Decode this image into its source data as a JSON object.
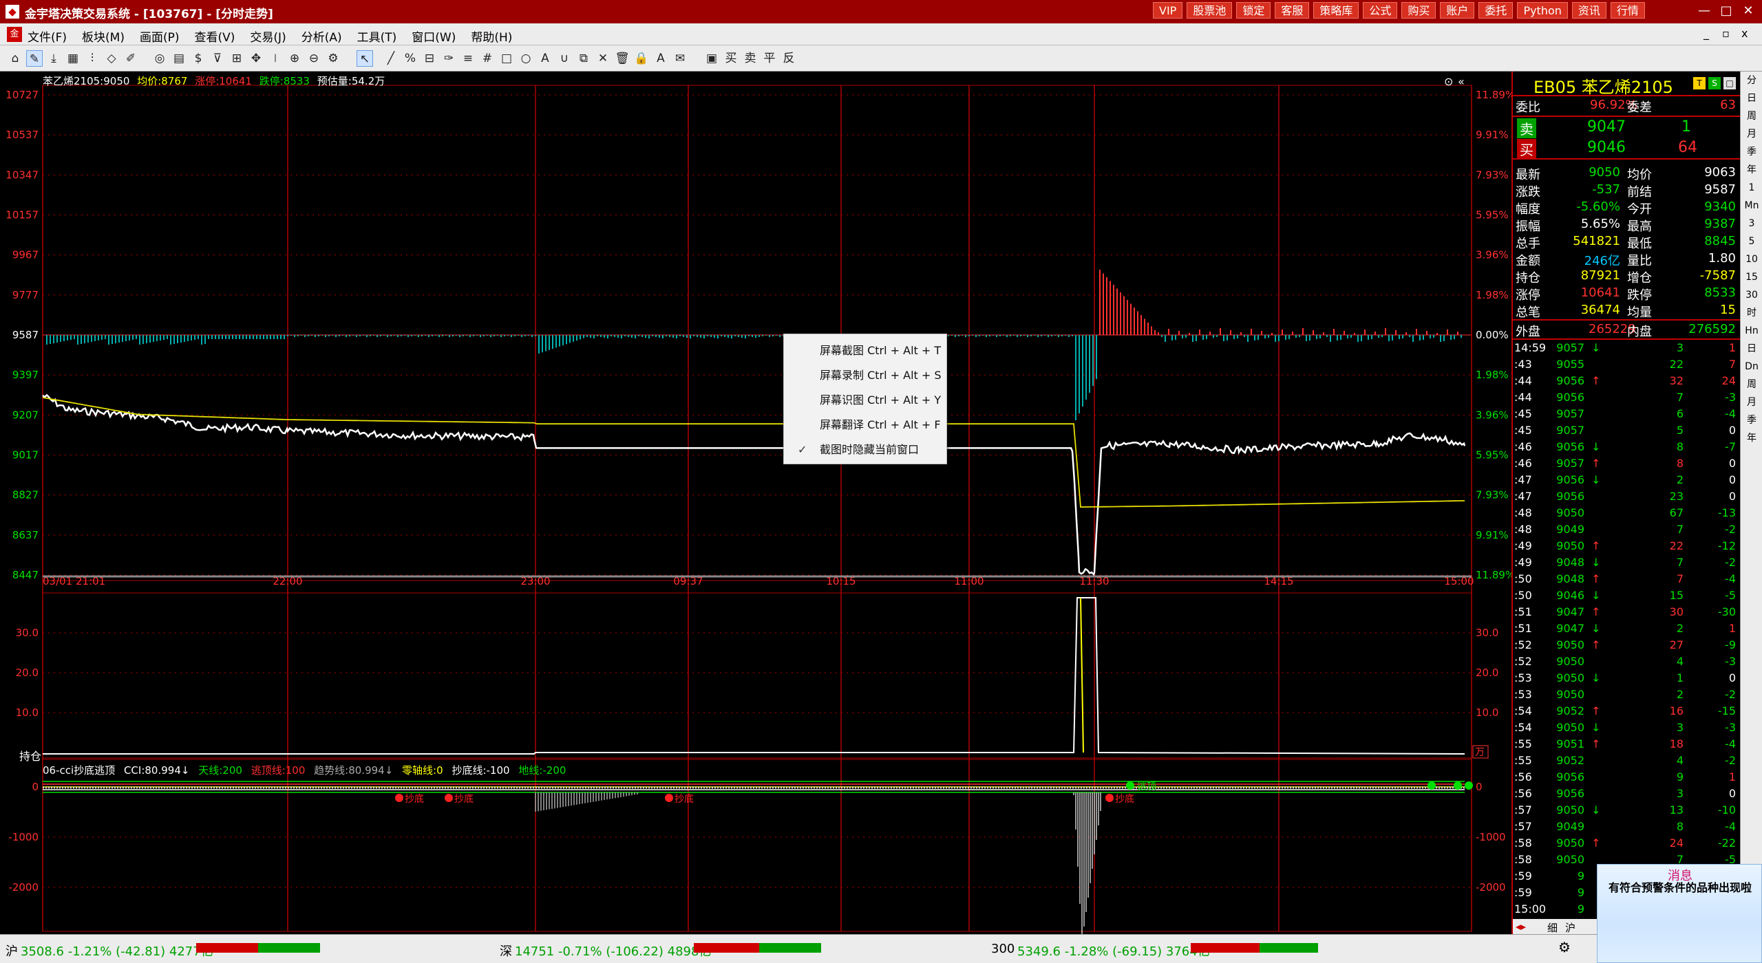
{
  "window": {
    "title": "金宇塔决策交易系统 - [103767] - [分时走势]",
    "buttons": [
      "VIP",
      "股票池",
      "锁定",
      "客服",
      "策略库",
      "公式",
      "购买",
      "账户",
      "委托",
      "Python",
      "资讯",
      "行情"
    ],
    "win_controls": [
      "—",
      "□",
      "✕"
    ],
    "mdi_controls": [
      "_",
      "▫",
      "x"
    ]
  },
  "menu": {
    "items": [
      "文件(F)",
      "板块(M)",
      "画面(P)",
      "查看(V)",
      "交易(J)",
      "分析(A)",
      "工具(T)",
      "窗口(W)",
      "帮助(H)"
    ]
  },
  "toolbar": {
    "icons": [
      {
        "name": "home-icon",
        "glyph": "⌂"
      },
      {
        "name": "draw-icon",
        "glyph": "✎"
      },
      {
        "name": "download-icon",
        "glyph": "⤓"
      },
      {
        "name": "layout-icon",
        "glyph": "▦"
      },
      {
        "name": "kline-icon",
        "glyph": "⫶"
      },
      {
        "name": "diamond-icon",
        "glyph": "◇"
      },
      {
        "name": "edit-icon",
        "glyph": "✐"
      },
      {
        "name": "target-icon",
        "glyph": "◎"
      },
      {
        "name": "book-icon",
        "glyph": "▤"
      },
      {
        "name": "dollar-icon",
        "glyph": "$"
      },
      {
        "name": "filter-icon",
        "glyph": "⊽"
      },
      {
        "name": "table-icon",
        "glyph": "⊞"
      },
      {
        "name": "move-icon",
        "glyph": "✥"
      },
      {
        "name": "pipe-icon",
        "glyph": "⧘"
      },
      {
        "name": "zoom-in-icon",
        "glyph": "⊕"
      },
      {
        "name": "zoom-out-icon",
        "glyph": "⊖"
      },
      {
        "name": "gear-icon",
        "glyph": "⚙"
      },
      {
        "name": "pointer-icon",
        "glyph": "↖"
      },
      {
        "name": "line-icon",
        "glyph": "╱"
      },
      {
        "name": "percent-icon",
        "glyph": "%"
      },
      {
        "name": "ruler-icon",
        "glyph": "⊟"
      },
      {
        "name": "pen-icon",
        "glyph": "✑"
      },
      {
        "name": "hlines-icon",
        "glyph": "≡"
      },
      {
        "name": "grid-icon",
        "glyph": "#"
      },
      {
        "name": "rect-icon",
        "glyph": "□"
      },
      {
        "name": "ellipse-icon",
        "glyph": "○"
      },
      {
        "name": "text-icon",
        "glyph": "A"
      },
      {
        "name": "magnet-icon",
        "glyph": "∪"
      },
      {
        "name": "copy-icon",
        "glyph": "⧉"
      },
      {
        "name": "delete-icon",
        "glyph": "✕"
      },
      {
        "name": "trash-icon",
        "glyph": "🗑"
      },
      {
        "name": "lock-icon",
        "glyph": "🔒"
      },
      {
        "name": "color-icon",
        "glyph": "A"
      },
      {
        "name": "mail-icon",
        "glyph": "✉"
      },
      {
        "name": "save-icon",
        "glyph": "▣"
      },
      {
        "name": "buy-icon",
        "glyph": "买"
      },
      {
        "name": "sell-icon",
        "glyph": "卖"
      },
      {
        "name": "flat-icon",
        "glyph": "平"
      },
      {
        "name": "reverse-icon",
        "glyph": "反"
      }
    ]
  },
  "chart": {
    "header": {
      "name": "苯乙烯2105:9050",
      "avg": "均价:8767",
      "limit_up": "涨停:10641",
      "limit_down": "跌停:8533",
      "est_vol": "预估量:54.2万"
    },
    "y_left": [
      "10727",
      "10537",
      "10347",
      "10157",
      "9967",
      "9777",
      "9587",
      "9397",
      "9207",
      "9017",
      "8827",
      "8637",
      "8447"
    ],
    "y_right": [
      "11.89%",
      "9.91%",
      "7.93%",
      "5.95%",
      "3.96%",
      "1.98%",
      "0.00%",
      "1.98%",
      "3.96%",
      "5.95%",
      "7.93%",
      "9.91%",
      "11.89%"
    ],
    "x_labels": [
      "03/01 21:01",
      "22:00",
      "23:00",
      "09:37",
      "10:15",
      "11:00",
      "11:30",
      "14:15",
      "15:00"
    ],
    "oi_y": [
      "30.0",
      "20.0",
      "10.0"
    ],
    "oi_label": "持仓",
    "oi_unit": "万",
    "indicator": {
      "name": "06-cci抄底逃顶",
      "cci": "CCI:80.994↓",
      "sky": "天线:200",
      "escape": "逃顶线:100",
      "trend": "趋势线:80.994↓",
      "zero": "零轴线:0",
      "bottom": "抄底线:-100",
      "ground": "地线:-200"
    },
    "ind_y": [
      "0",
      "-1000",
      "-2000"
    ],
    "marker_label": "抄底",
    "marker_label_top": "逃顶"
  },
  "chart_data": {
    "type": "line",
    "title": "苯乙烯2105",
    "x": [
      "21:01",
      "22:00",
      "23:00",
      "09:37",
      "10:15",
      "11:00",
      "11:30",
      "14:15",
      "15:00"
    ],
    "series": [
      {
        "name": "价格",
        "values": [
          9300,
          9150,
          9080,
          9050,
          9050,
          9050,
          8470,
          9040,
          9050
        ]
      },
      {
        "name": "均价",
        "values": [
          9290,
          9200,
          9150,
          9150,
          9150,
          9150,
          8775,
          8780,
          8800
        ]
      }
    ],
    "ylim": [
      8447,
      10727
    ]
  },
  "quote": {
    "code": "EB05",
    "name": "苯乙烯2105",
    "badges": [
      "T",
      "S",
      "□"
    ],
    "weibi_label": "委比",
    "weibi": "96.92%",
    "weicha_label": "委差",
    "weicha": "63",
    "sell_label": "卖",
    "sell_price": "9047",
    "sell_vol": "1",
    "buy_label": "买",
    "buy_price": "9046",
    "buy_vol": "64",
    "rows": [
      {
        "l1": "最新",
        "v1": "9050",
        "l2": "均价",
        "v2": "9063",
        "c1": "#00e000",
        "c2": "#ffffff"
      },
      {
        "l1": "涨跌",
        "v1": "-537",
        "l2": "前结",
        "v2": "9587",
        "c1": "#00e000",
        "c2": "#ffffff"
      },
      {
        "l1": "幅度",
        "v1": "-5.60%",
        "l2": "今开",
        "v2": "9340",
        "c1": "#00e000",
        "c2": "#00e000"
      },
      {
        "l1": "振幅",
        "v1": "5.65%",
        "l2": "最高",
        "v2": "9387",
        "c1": "#ffffff",
        "c2": "#00e000"
      },
      {
        "l1": "总手",
        "v1": "541821",
        "l2": "最低",
        "v2": "8845",
        "c1": "#ffff00",
        "c2": "#00e000"
      },
      {
        "l1": "金额",
        "v1": "246亿",
        "l2": "量比",
        "v2": "1.80",
        "c1": "#00c8ff",
        "c2": "#ffffff"
      },
      {
        "l1": "持仓",
        "v1": "87921",
        "l2": "增仓",
        "v2": "-7587",
        "c1": "#ffff00",
        "c2": "#ffff00"
      },
      {
        "l1": "涨停",
        "v1": "10641",
        "l2": "跌停",
        "v2": "8533",
        "c1": "#ff3030",
        "c2": "#00e000"
      },
      {
        "l1": "总笔",
        "v1": "36474",
        "l2": "均量",
        "v2": "15",
        "c1": "#ffff00",
        "c2": "#ffff00"
      }
    ],
    "outer_label": "外盘",
    "outer": "265229",
    "inner_label": "内盘",
    "inner": "276592"
  },
  "ticks": [
    {
      "t": "14:59",
      "p": "9057",
      "d": "↓",
      "v": "3",
      "c": "1"
    },
    {
      "t": ":43",
      "p": "9055",
      "d": "",
      "v": "22",
      "c": "7"
    },
    {
      "t": ":44",
      "p": "9056",
      "d": "↑",
      "v": "32",
      "c": "24"
    },
    {
      "t": ":44",
      "p": "9056",
      "d": "",
      "v": "7",
      "c": "-3"
    },
    {
      "t": ":45",
      "p": "9057",
      "d": "",
      "v": "6",
      "c": "-4"
    },
    {
      "t": ":45",
      "p": "9057",
      "d": "",
      "v": "5",
      "c": "0"
    },
    {
      "t": ":46",
      "p": "9056",
      "d": "↓",
      "v": "8",
      "c": "-7"
    },
    {
      "t": ":46",
      "p": "9057",
      "d": "↑",
      "v": "8",
      "c": "0"
    },
    {
      "t": ":47",
      "p": "9056",
      "d": "↓",
      "v": "2",
      "c": "0"
    },
    {
      "t": ":47",
      "p": "9056",
      "d": "",
      "v": "23",
      "c": "0"
    },
    {
      "t": ":48",
      "p": "9050",
      "d": "",
      "v": "67",
      "c": "-13"
    },
    {
      "t": ":48",
      "p": "9049",
      "d": "",
      "v": "7",
      "c": "-2"
    },
    {
      "t": ":49",
      "p": "9050",
      "d": "↑",
      "v": "22",
      "c": "-12"
    },
    {
      "t": ":49",
      "p": "9048",
      "d": "↓",
      "v": "7",
      "c": "-2"
    },
    {
      "t": ":50",
      "p": "9048",
      "d": "↑",
      "v": "7",
      "c": "-4"
    },
    {
      "t": ":50",
      "p": "9046",
      "d": "↓",
      "v": "15",
      "c": "-5"
    },
    {
      "t": ":51",
      "p": "9047",
      "d": "↑",
      "v": "30",
      "c": "-30"
    },
    {
      "t": ":51",
      "p": "9047",
      "d": "↓",
      "v": "2",
      "c": "1"
    },
    {
      "t": ":52",
      "p": "9050",
      "d": "↑",
      "v": "27",
      "c": "-9"
    },
    {
      "t": ":52",
      "p": "9050",
      "d": "",
      "v": "4",
      "c": "-3"
    },
    {
      "t": ":53",
      "p": "9050",
      "d": "↓",
      "v": "1",
      "c": "0"
    },
    {
      "t": ":53",
      "p": "9050",
      "d": "",
      "v": "2",
      "c": "-2"
    },
    {
      "t": ":54",
      "p": "9052",
      "d": "↑",
      "v": "16",
      "c": "-15"
    },
    {
      "t": ":54",
      "p": "9050",
      "d": "↓",
      "v": "3",
      "c": "-3"
    },
    {
      "t": ":55",
      "p": "9051",
      "d": "↑",
      "v": "18",
      "c": "-4"
    },
    {
      "t": ":55",
      "p": "9052",
      "d": "",
      "v": "4",
      "c": "-2"
    },
    {
      "t": ":56",
      "p": "9056",
      "d": "",
      "v": "9",
      "c": "1"
    },
    {
      "t": ":56",
      "p": "9056",
      "d": "",
      "v": "3",
      "c": "0"
    },
    {
      "t": ":57",
      "p": "9050",
      "d": "↓",
      "v": "13",
      "c": "-10"
    },
    {
      "t": ":57",
      "p": "9049",
      "d": "",
      "v": "8",
      "c": "-4"
    },
    {
      "t": ":58",
      "p": "9050",
      "d": "↑",
      "v": "24",
      "c": "-22"
    },
    {
      "t": ":58",
      "p": "9050",
      "d": "",
      "v": "7",
      "c": "-5"
    },
    {
      "t": ":59",
      "p": "9",
      "d": "",
      "v": "",
      "c": ""
    },
    {
      "t": ":59",
      "p": "9",
      "d": "",
      "v": "",
      "c": ""
    },
    {
      "t": "15:00",
      "p": "9",
      "d": "",
      "v": "",
      "c": ""
    }
  ],
  "tabs_bottom": [
    "细",
    "沪"
  ],
  "side_strip": [
    "分",
    "日",
    "周",
    "月",
    "季",
    "年",
    "1",
    "Mn",
    "3",
    "5",
    "10",
    "15",
    "30",
    "时",
    "Hn",
    "日",
    "Dn",
    "周",
    "月",
    "季",
    "年"
  ],
  "context_menu": {
    "items": [
      {
        "label": "屏幕截图 Ctrl + Alt + T",
        "checked": false
      },
      {
        "label": "屏幕录制 Ctrl + Alt + S",
        "checked": false
      },
      {
        "label": "屏幕识图 Ctrl + Alt + Y",
        "checked": false
      },
      {
        "label": "屏幕翻译 Ctrl + Alt + F",
        "checked": false
      },
      {
        "label": "截图时隐藏当前窗口",
        "checked": true
      }
    ]
  },
  "message": {
    "title": "消息",
    "body": "有符合预警条件的品种出现啦"
  },
  "status": {
    "sh_label": "沪",
    "sh": "3508.6 -1.21% (-42.81) 4277亿",
    "sz_label": "深",
    "sz": "14751 -0.71% (-106.22) 4898亿",
    "hs_label": "300",
    "hs": "5349.6 -1.28% (-69.15) 3764亿"
  },
  "colors": {
    "up": "#ff3030",
    "down": "#00e000",
    "grid": "#b00000",
    "price": "#ffffff",
    "avg": "#e8e000"
  }
}
